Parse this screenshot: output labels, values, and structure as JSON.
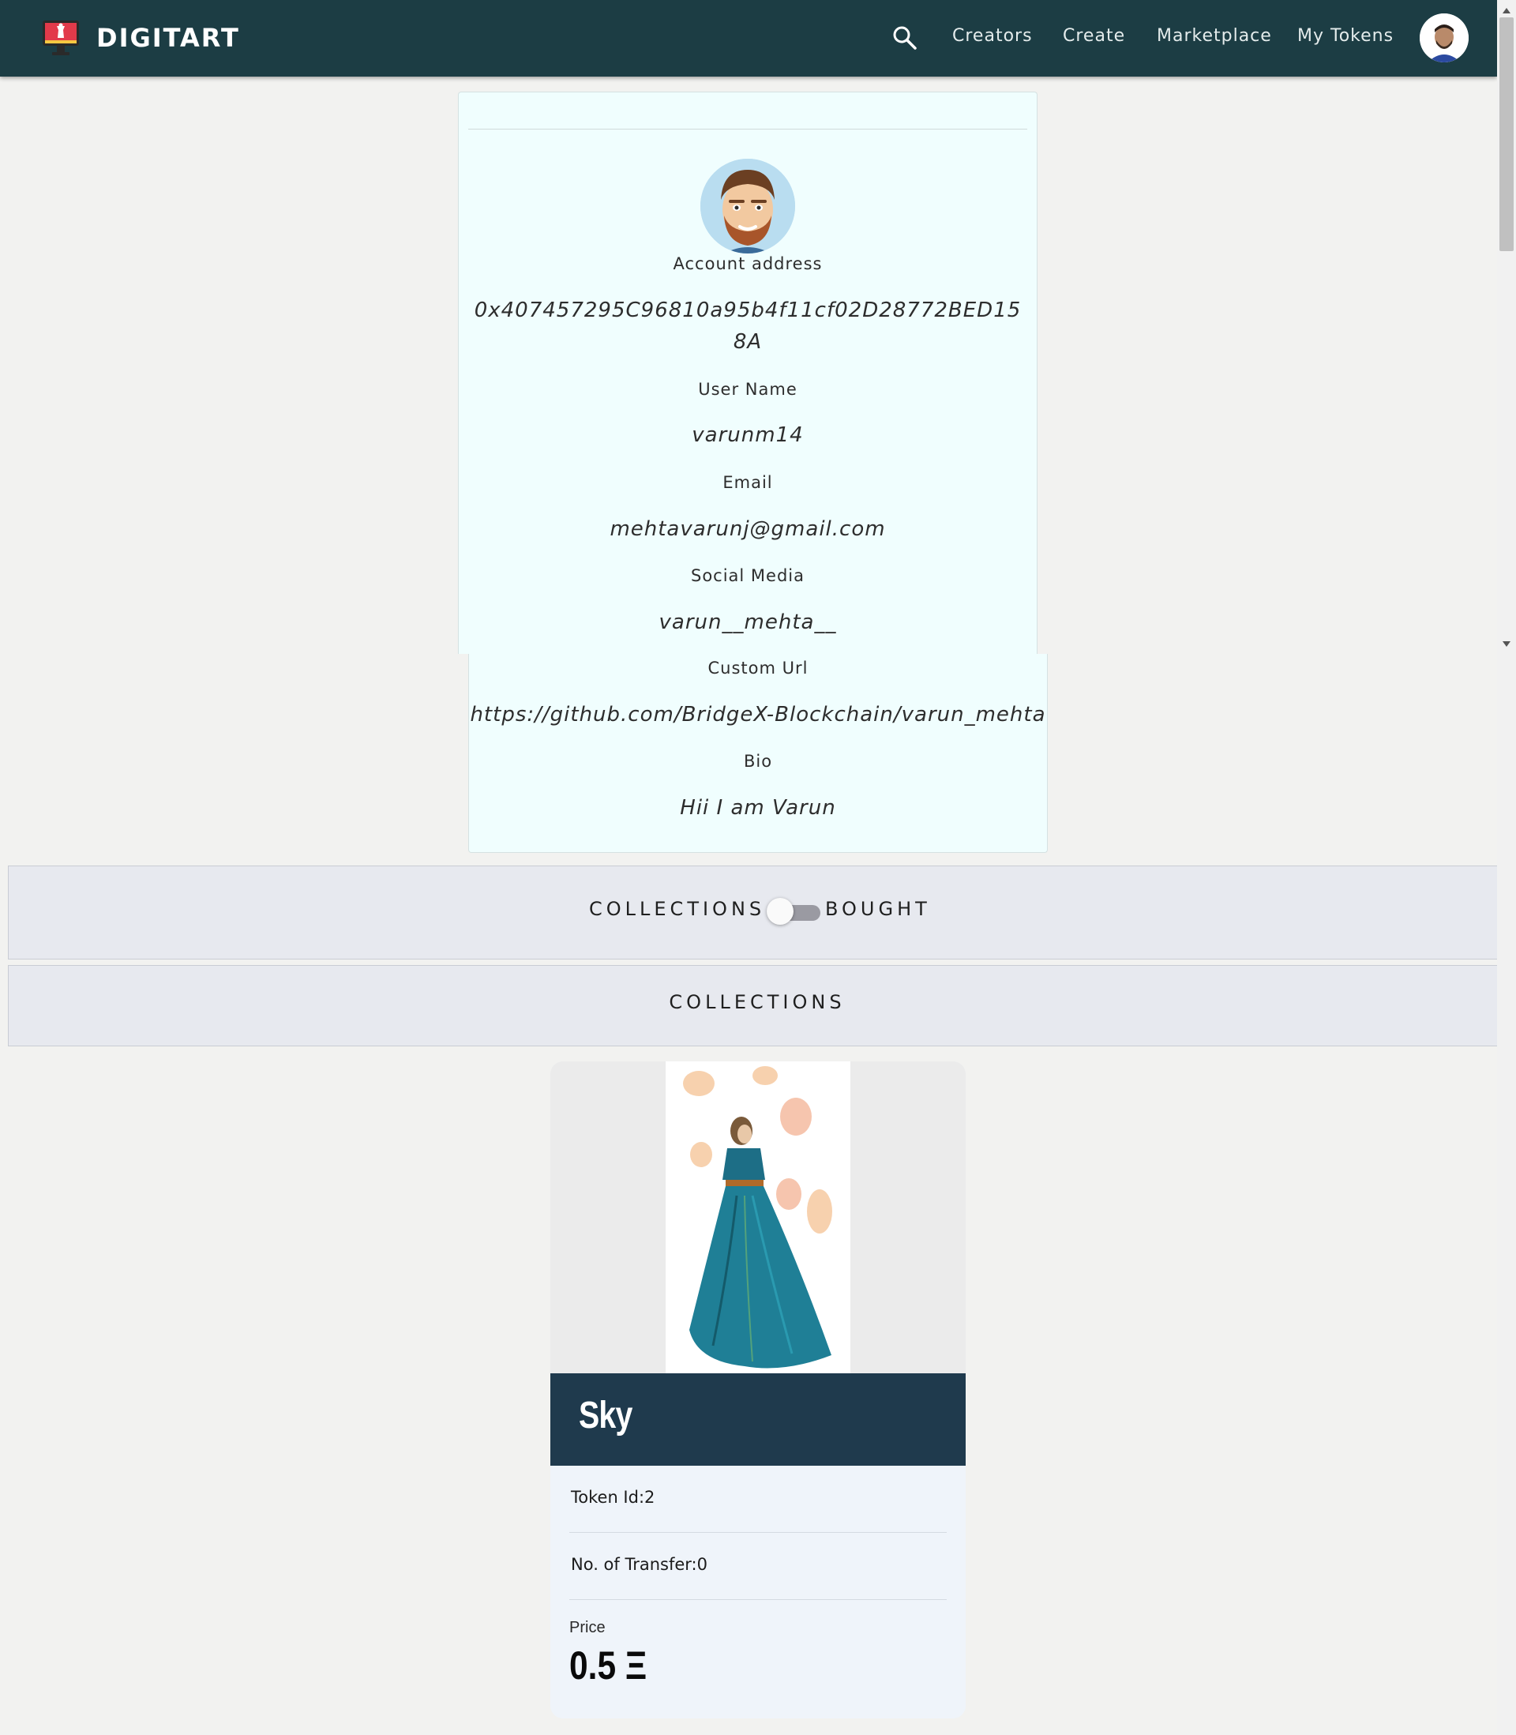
{
  "navbar": {
    "brand": "DIGITART",
    "links": [
      "Creators",
      "Create",
      "Marketplace",
      "My Tokens"
    ],
    "icons": {
      "search": "search-icon",
      "avatar": "user-avatar"
    }
  },
  "profile": {
    "account_label": "Account address",
    "account_value": "0x407457295C96810a95b4f11cf02D28772BED158A",
    "username_label": "User Name",
    "username_value": "varunm14",
    "email_label": "Email",
    "email_value": "mehtavarunj@gmail.com",
    "social_label": "Social Media",
    "social_value": "varun__mehta__",
    "url_label": "Custom Url",
    "url_value": "https://github.com/BridgeX-Blockchain/varun_mehta",
    "bio_label": "Bio",
    "bio_value": "Hii I am Varun"
  },
  "toggle": {
    "left_label": "COLLECTIONS",
    "right_label": "BOUGHT",
    "state": "off"
  },
  "section": {
    "title": "COLLECTIONS"
  },
  "nft": {
    "title": "Sky",
    "token_id": "Token Id:2",
    "transfers": "No. of Transfer:0",
    "price_label": "Price",
    "price_value": "0.5 Ξ"
  },
  "colors": {
    "navbar": "#1c3d44",
    "profile_card": "#f0fefe",
    "banner": "#e7e9ef",
    "nft_title_bar": "#1f3a4d",
    "nft_card": "#eff4fa"
  }
}
